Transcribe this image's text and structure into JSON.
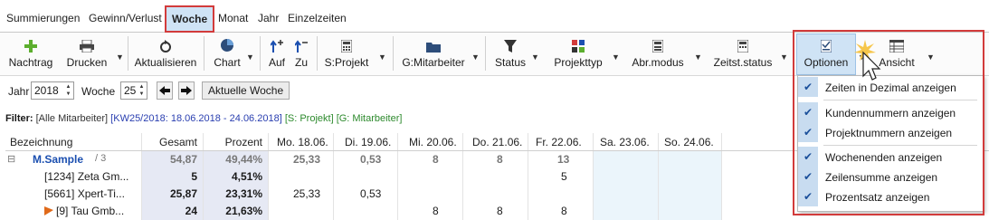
{
  "tabs": [
    "Summierungen",
    "Gewinn/Verlust",
    "Woche",
    "Monat",
    "Jahr",
    "Einzelzeiten"
  ],
  "active_tab": "Woche",
  "toolbar": {
    "nachtrag": "Nachtrag",
    "drucken": "Drucken",
    "aktualisieren": "Aktualisieren",
    "chart": "Chart",
    "auf": "Auf",
    "zu": "Zu",
    "sprojekt": "S:Projekt",
    "gmitarbeiter": "G:Mitarbeiter",
    "status": "Status",
    "projekttyp": "Projekttyp",
    "abrmodus": "Abr.modus",
    "zeitststatus": "Zeitst.status",
    "optionen": "Optionen",
    "ansicht": "Ansicht"
  },
  "daterow": {
    "jahr_label": "Jahr",
    "jahr_value": "2018",
    "woche_label": "Woche",
    "woche_value": "25",
    "current_week": "Aktuelle Woche"
  },
  "filter": {
    "label": "Filter:",
    "mitarbeiter": "[Alle Mitarbeiter]",
    "kw": "[KW25/2018: 18.06.2018 - 24.06.2018]",
    "sprojekt": "[S: Projekt]",
    "gmitarbeiter": "[G: Mitarbeiter]"
  },
  "grid": {
    "headers": [
      "Bezeichnung",
      "Gesamt",
      "Prozent",
      "Mo. 18.06.",
      "Di. 19.06.",
      "Mi. 20.06.",
      "Do. 21.06.",
      "Fr. 22.06.",
      "Sa. 23.06.",
      "So. 24.06."
    ],
    "group": {
      "toggle": "⊟",
      "name": "M.Sample",
      "count": "/ 3",
      "gesamt": "54,87",
      "prozent": "49,44%",
      "mo": "25,33",
      "di": "0,53",
      "mi": "8",
      "do": "8",
      "fr": "13"
    },
    "rows": [
      {
        "name": "[1234] Zeta Gm...",
        "gesamt": "5",
        "prozent": "4,51%",
        "mo": "",
        "di": "",
        "mi": "",
        "do": "",
        "fr": "5"
      },
      {
        "name": "[5661] Xpert-Ti...",
        "gesamt": "25,87",
        "prozent": "23,31%",
        "mo": "25,33",
        "di": "0,53",
        "mi": "",
        "do": "",
        "fr": ""
      },
      {
        "name": "[9] Tau Gmb...",
        "gesamt": "24",
        "prozent": "21,63%",
        "mo": "",
        "di": "",
        "mi": "8",
        "do": "8",
        "fr": "8"
      }
    ]
  },
  "menu": {
    "items": [
      "Zeiten in Dezimal anzeigen",
      "Kundennummern anzeigen",
      "Projektnummern anzeigen",
      "Wochenenden anzeigen",
      "Zeilensumme anzeigen",
      "Prozentsatz anzeigen"
    ],
    "checked": [
      true,
      true,
      true,
      true,
      true,
      true
    ]
  },
  "colors": {
    "accent_red": "#d23b3b",
    "selected_blue": "#cfe3f5",
    "filter_blue": "#2a3fb0",
    "filter_green": "#2d8a2d"
  }
}
